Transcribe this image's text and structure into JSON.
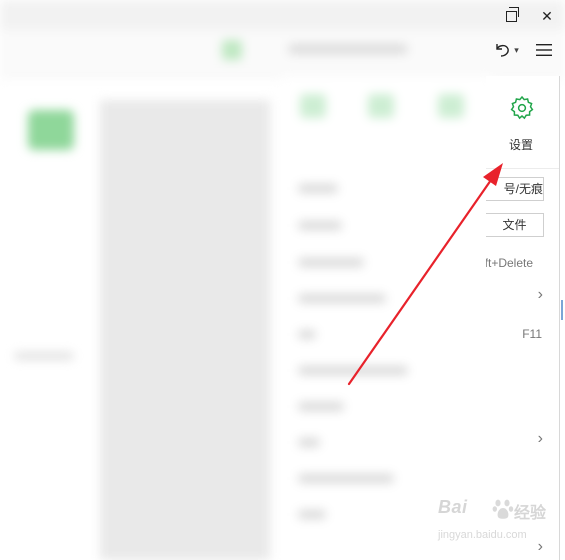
{
  "window": {
    "restore_icon": "restore-icon",
    "close_glyph": "✕"
  },
  "toolbar": {
    "undo_icon": "undo-icon",
    "undo_dropdown_glyph": "▾",
    "menu_icon": "hamburger-icon"
  },
  "menu": {
    "settings": {
      "label": "设置",
      "icon": "gear-icon",
      "color": "#21a54a"
    },
    "private_label": "号/无痕",
    "file_label": "文件",
    "delete_shortcut": "ift+Delete",
    "fullscreen_shortcut": "F11",
    "chevron_glyph": "›"
  },
  "watermark": {
    "brand": "Bai",
    "brand_cn": "经验",
    "url": "jingyan.baidu.com"
  },
  "annotation": {
    "arrow_color": "#e8222b"
  }
}
